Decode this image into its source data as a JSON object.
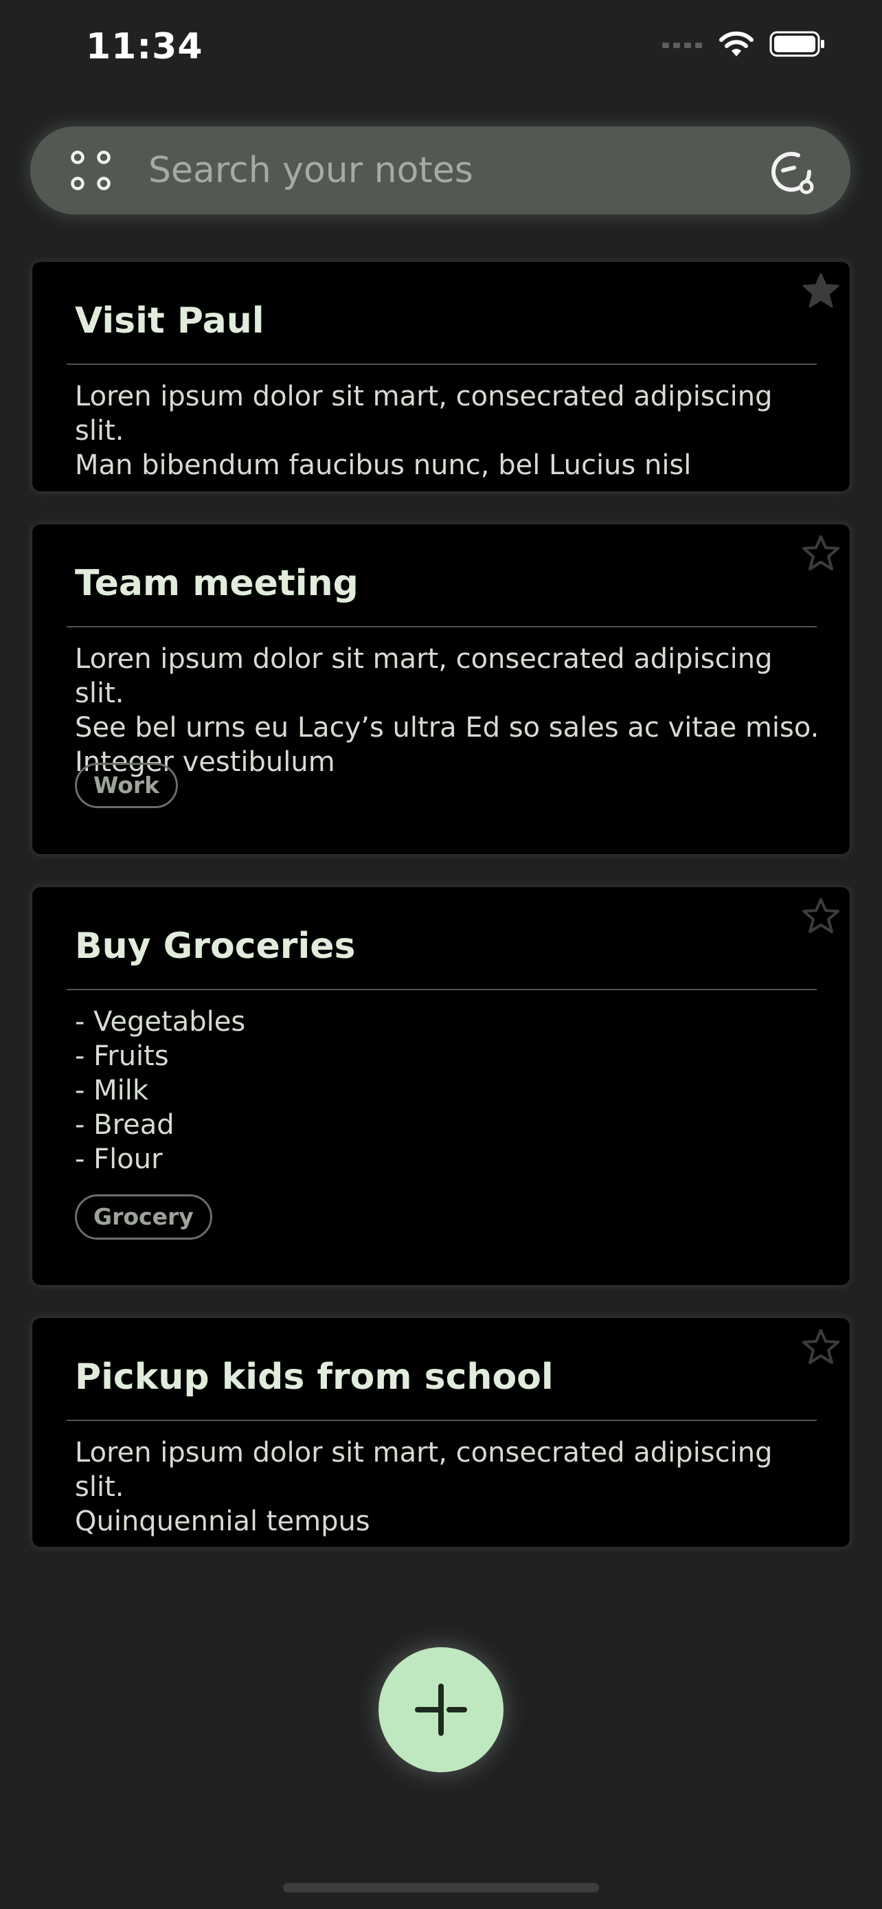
{
  "status_bar": {
    "time": "11:34"
  },
  "search": {
    "placeholder": "Search your notes",
    "left_icon": "grid-dots-icon",
    "right_icon": "refresh-sync-icon"
  },
  "notes": [
    {
      "title": "Visit Paul",
      "body": "Loren ipsum dolor sit mart, consecrated adipiscing slit.\nMan bibendum faucibus nunc, bel Lucius nisl",
      "pinned": true,
      "tag": ""
    },
    {
      "title": "Team meeting",
      "body": "Loren ipsum dolor sit mart, consecrated adipiscing slit.\nSee bel urns eu Lacy’s ultra Ed so sales ac vitae miso.\nInteger vestibulum",
      "pinned": false,
      "tag": "Work"
    },
    {
      "title": "Buy Groceries",
      "body": "- Vegetables\n- Fruits\n- Milk\n- Bread\n- Flour",
      "pinned": false,
      "tag": "Grocery"
    },
    {
      "title": "Pickup kids from school",
      "body": "Loren ipsum dolor sit mart, consecrated adipiscing slit.\nQuinquennial tempus",
      "pinned": false,
      "tag": ""
    }
  ],
  "fab": {
    "icon": "plus-icon"
  },
  "colors": {
    "background": "#202122",
    "card": "#000000",
    "search_bar": "#535952",
    "accent": "#bfe8c0",
    "title_text": "#e1ecdc"
  }
}
